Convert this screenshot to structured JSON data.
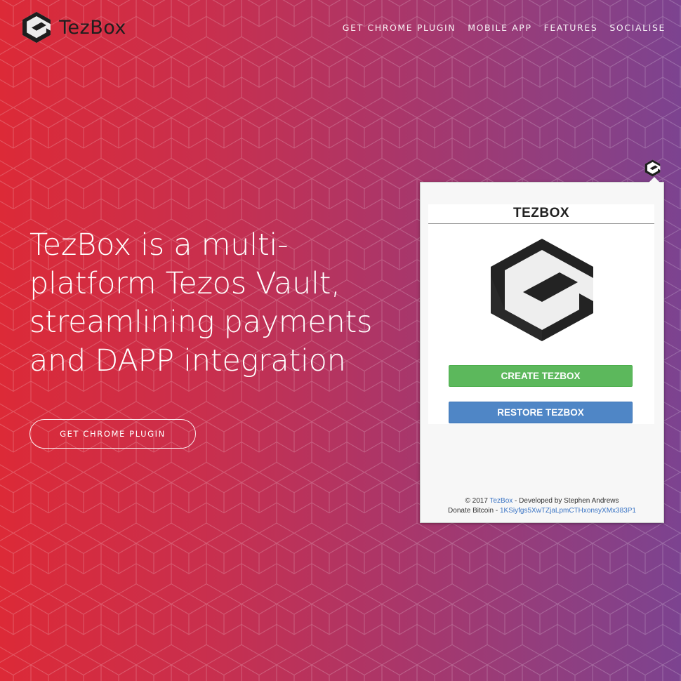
{
  "brand": {
    "name": "TezBox",
    "icon": "tezbox-logo-icon"
  },
  "nav": {
    "items": [
      {
        "label": "GET CHROME PLUGIN"
      },
      {
        "label": "MOBILE APP"
      },
      {
        "label": "FEATURES"
      },
      {
        "label": "SOCIALISE"
      }
    ]
  },
  "hero": {
    "lines": [
      "TezBox is a multi-",
      "platform Tezos Vault,",
      "streamlining payments",
      "and DAPP integration"
    ],
    "cta_label": "GET CHROME PLUGIN"
  },
  "popup": {
    "icon": "tezbox-extension-icon",
    "title": "TEZBOX",
    "create_label": "CREATE TEZBOX",
    "restore_label": "RESTORE TEZBOX",
    "footer": {
      "copyright_prefix": "© 2017 ",
      "brand_link": "TezBox",
      "developer_text": " - Developed by Stephen Andrews",
      "donate_prefix": "Donate Bitcoin - ",
      "bitcoin_address": "1KSiyfgs5XwTZjaLpmCTHxonsyXMx383P1"
    }
  },
  "colors": {
    "gradient_left": "#dc2a37",
    "gradient_right": "#7c4390",
    "create_button": "#5cb85c",
    "restore_button": "#4f86c6",
    "link": "#3a74c4"
  }
}
